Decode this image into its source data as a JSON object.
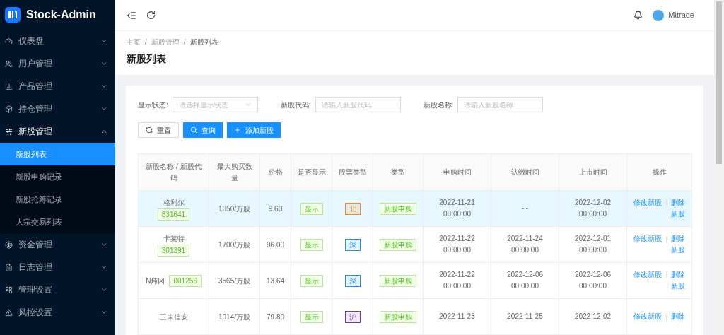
{
  "brand": "Stock-Admin",
  "sidebar": {
    "items": [
      {
        "label": "仪表盘",
        "expanded": false
      },
      {
        "label": "用户管理",
        "expanded": false
      },
      {
        "label": "产品管理",
        "expanded": false
      },
      {
        "label": "持仓管理",
        "expanded": false
      },
      {
        "label": "新股管理",
        "expanded": true,
        "children": [
          {
            "label": "新股列表",
            "selected": true
          },
          {
            "label": "新股申购记录",
            "selected": false
          },
          {
            "label": "新股抢筹记录",
            "selected": false
          },
          {
            "label": "大宗交易列表",
            "selected": false
          }
        ]
      },
      {
        "label": "资金管理",
        "expanded": false
      },
      {
        "label": "日志管理",
        "expanded": false
      },
      {
        "label": "管理设置",
        "expanded": false
      },
      {
        "label": "风控设置",
        "expanded": false
      }
    ]
  },
  "user": "Mitrade",
  "breadcrumb": {
    "separator": "/",
    "items": [
      "主页",
      "新股管理",
      "新股列表"
    ]
  },
  "page_title": "新股列表",
  "filters": [
    {
      "kind": "select",
      "label": "显示状态:",
      "placeholder": "请选择显示状态"
    },
    {
      "kind": "input",
      "label": "新股代码:",
      "placeholder": "请输入新股代码"
    },
    {
      "kind": "input",
      "label": "新股名称:",
      "placeholder": "请输入新股名称"
    }
  ],
  "buttons": [
    {
      "kind": "reset",
      "label": "重置"
    },
    {
      "kind": "search",
      "label": "查询"
    },
    {
      "kind": "add",
      "label": "添加新股"
    }
  ],
  "table": {
    "columns": [
      "新股名称 / 新股代码",
      "最大购买数量",
      "价格",
      "是否显示",
      "股票类型",
      "类型",
      "申购时间",
      "认缴时间",
      "上市时间",
      "操作"
    ],
    "rows": [
      {
        "selected": true,
        "name": "格利尔",
        "code": "831641",
        "inline": false,
        "amount": "1050/万股",
        "price": "9.60",
        "display": "显示",
        "market": "北",
        "color": "#fa8c16",
        "type": "新股申购",
        "subscribe": [
          "2022-11-21",
          "00:00:00"
        ],
        "pay": [
          "- -"
        ],
        "listing": [
          "2022-12-02",
          "00:00:00"
        ],
        "actions": [
          "修改新股",
          "删除新股"
        ]
      },
      {
        "selected": false,
        "name": "卡莱特",
        "code": "301391",
        "inline": false,
        "amount": "1700/万股",
        "price": "96.00",
        "display": "显示",
        "market": "深",
        "color": "#1890ff",
        "type": "新股申购",
        "subscribe": [
          "2022-11-22",
          "00:00:00"
        ],
        "pay": [
          "2022-11-24",
          "00:00:00"
        ],
        "listing": [
          "2022-12-01",
          "00:00:00"
        ],
        "actions": [
          "修改新股",
          "删除新股"
        ]
      },
      {
        "selected": false,
        "name": "N炜冈",
        "code": "001256",
        "inline": true,
        "amount": "3565/万股",
        "price": "13.64",
        "display": "显示",
        "market": "深",
        "color": "#1890ff",
        "type": "新股申购",
        "subscribe": [
          "2022-11-22",
          "00:00:00"
        ],
        "pay": [
          "2022-12-06",
          "00:00:00"
        ],
        "listing": [
          "2022-12-06",
          "00:00:00"
        ],
        "actions": [
          "修改新股",
          "删除新股"
        ]
      },
      {
        "selected": false,
        "name": "三未信安",
        "amount": "1014/万股",
        "price": "79.80",
        "display": "显示",
        "market": "沪",
        "color": "#722ed1",
        "type": "新股申购",
        "subscribe": [
          "2022-11-23"
        ],
        "pay": [
          "2022-11-25"
        ],
        "listing": [
          "2022-12-02"
        ],
        "actions": [
          "修改新股",
          "删除"
        ]
      }
    ]
  }
}
